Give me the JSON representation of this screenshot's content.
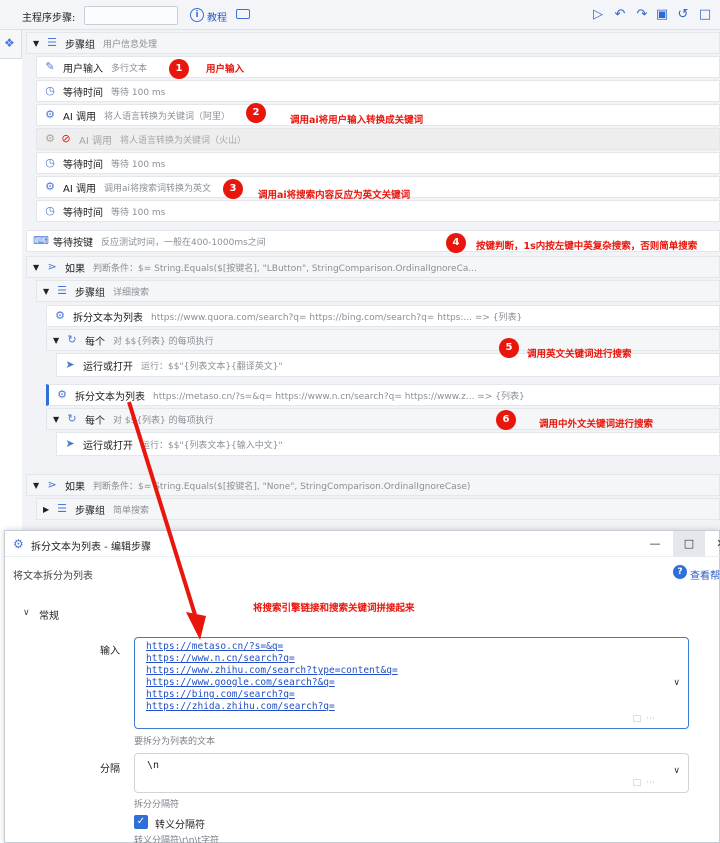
{
  "toolbar": {
    "main_steps_label": "主程序步骤:",
    "tutorial_label": "教程",
    "icons": [
      "run-icon",
      "undo-icon",
      "redo-icon",
      "save-icon",
      "history-icon",
      "export-icon"
    ]
  },
  "flow": {
    "group1": {
      "title": "步骤组",
      "desc": "用户信息处理"
    },
    "steps": [
      {
        "title": "用户输入",
        "desc": "多行文本"
      },
      {
        "title": "等待时间",
        "desc": "等待 100 ms"
      },
      {
        "title": "AI 调用",
        "desc": "将人语言转换为关键词（阿里）"
      },
      {
        "title": "AI 调用",
        "desc": "将人语言转换为关键词（火山）"
      },
      {
        "title": "等待时间",
        "desc": "等待 100 ms"
      },
      {
        "title": "AI 调用",
        "desc": "调用ai将搜索词转换为英文"
      },
      {
        "title": "等待时间",
        "desc": "等待 100 ms"
      }
    ],
    "wait_key": {
      "title": "等待按键",
      "desc": "反应测试时间，一般在400-1000ms之间"
    },
    "if1": {
      "title": "如果",
      "desc": "判断条件：$= String.Equals($[按键名], \"LButton\", StringComparison.OrdinalIgnoreCa..."
    },
    "group2": {
      "title": "步骤组",
      "desc": "详细搜索"
    },
    "split1": {
      "title": "拆分文本为列表",
      "desc": "https://www.quora.com/search?q=  https://bing.com/search?q=  https:... => {列表}"
    },
    "each1": {
      "title": "每个",
      "desc": "对 $${列表} 的每项执行"
    },
    "run1": {
      "title": "运行或打开",
      "desc": "运行：$$\"{列表文本}{翻译英文}\""
    },
    "split2": {
      "title": "拆分文本为列表",
      "desc": "https://metaso.cn/?s=&q=  https://www.n.cn/search?q=  https://www.z... => {列表}"
    },
    "each2": {
      "title": "每个",
      "desc": "对 $${列表} 的每项执行"
    },
    "run2": {
      "title": "运行或打开",
      "desc": "运行：$$\"{列表文本}{输入中文}\""
    },
    "if2": {
      "title": "如果",
      "desc": "判断条件：$= String.Equals($[按键名], \"None\", StringComparison.OrdinalIgnoreCase)"
    },
    "group3": {
      "title": "步骤组",
      "desc": "简单搜索"
    }
  },
  "annotations": [
    {
      "num": "1",
      "text": "用户输入"
    },
    {
      "num": "2",
      "text": "调用ai将用户输入转换成关键词"
    },
    {
      "num": "3",
      "text": "调用ai将搜索内容反应为英文关键词"
    },
    {
      "num": "4",
      "text": "按键判断，1s内按左键中英复杂搜索，否则简单搜索"
    },
    {
      "num": "5",
      "text": "调用英文关键词进行搜索"
    },
    {
      "num": "6",
      "text": "调用中外文关键词进行搜索"
    },
    {
      "text": "将搜索引擎链接和搜索关键词拼接起来"
    }
  ],
  "dialog": {
    "title": "拆分文本为列表 - 编辑步骤",
    "subtitle": "将文本拆分为列表",
    "help_label": "查看帮",
    "section": "常规",
    "input_label": "输入",
    "input_lines": [
      "https://metaso.cn/?s=&q=",
      "https://www.n.cn/search?q=",
      "https://www.zhihu.com/search?type=content&q=",
      "https://www.google.com/search?&q=",
      "https://bing.com/search?q=",
      "https://zhida.zhihu.com/search?q="
    ],
    "input_hint": "要拆分为列表的文本",
    "sep_label": "分隔",
    "sep_value": "\\n",
    "sep_hint": "拆分分隔符",
    "escape_label": "转义分隔符",
    "escape_hint": "转义分隔符\\r\\n\\t字符"
  }
}
